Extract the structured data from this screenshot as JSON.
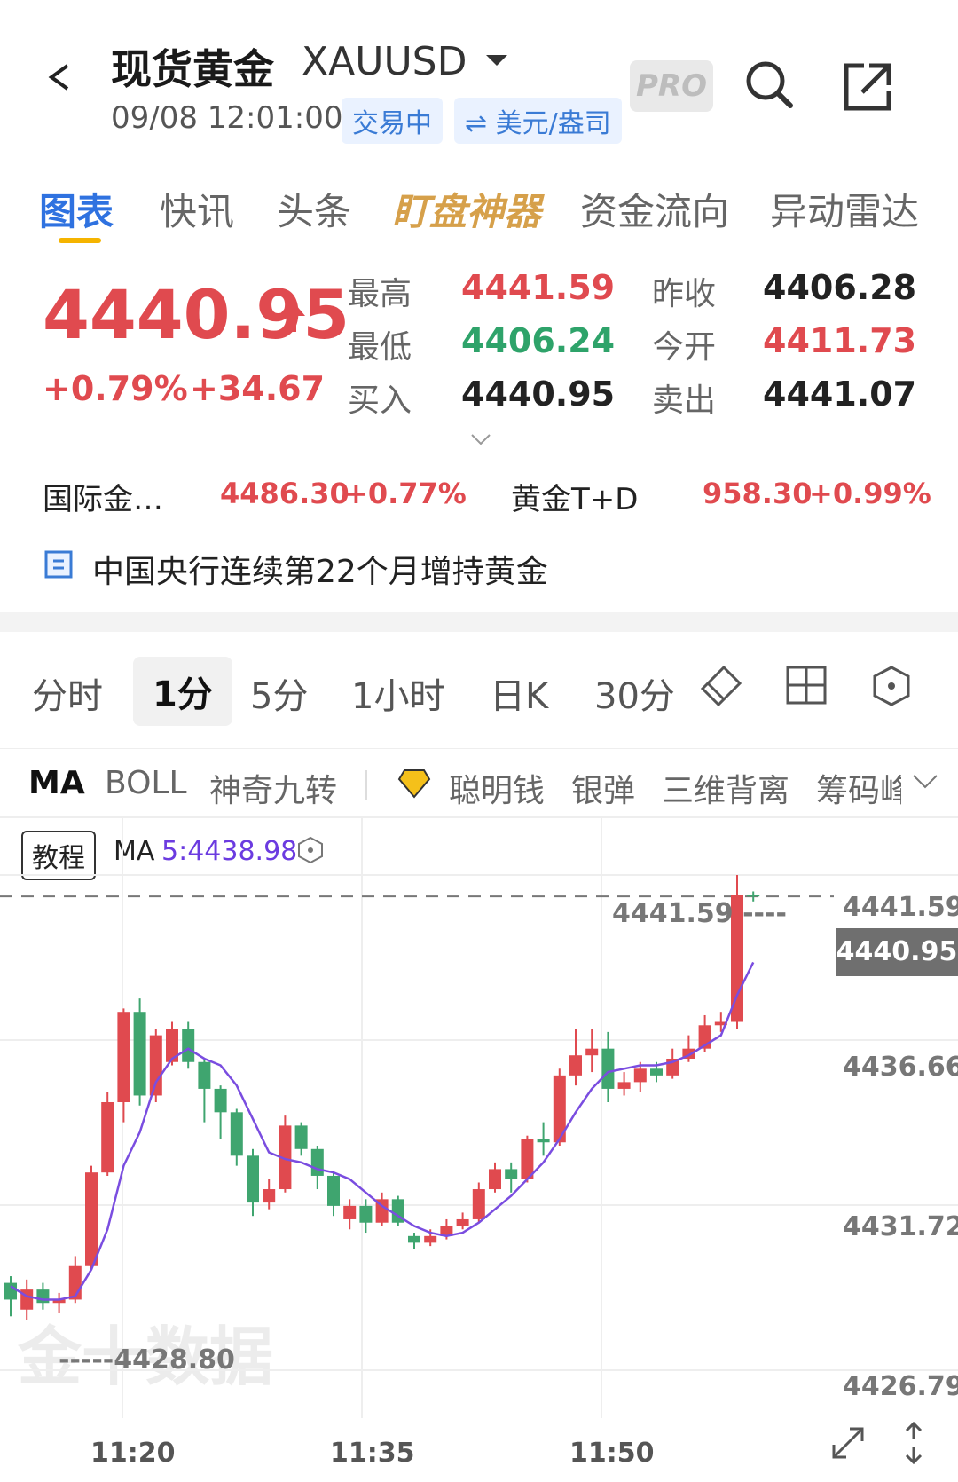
{
  "header": {
    "title": "现货黄金",
    "symbol": "XAUUSD",
    "datetime": "09/08 12:01:00",
    "status_badge": "交易中",
    "currency_badge": "⇌ 美元/盎司",
    "pro_label": "PRO"
  },
  "tabs": [
    {
      "label": "图表",
      "active": true
    },
    {
      "label": "快讯"
    },
    {
      "label": "头条"
    },
    {
      "label": "盯盘神器"
    },
    {
      "label": "资金流向"
    },
    {
      "label": "异动雷达"
    }
  ],
  "quote": {
    "price": "4440.95",
    "pct_change": "+0.79%",
    "abs_change": "+34.67",
    "stats": [
      {
        "label": "最高",
        "value": "4441.59",
        "color": "red"
      },
      {
        "label": "昨收",
        "value": "4406.28",
        "color": "dark"
      },
      {
        "label": "最低",
        "value": "4406.24",
        "color": "green"
      },
      {
        "label": "今开",
        "value": "4411.73",
        "color": "red"
      },
      {
        "label": "买入",
        "value": "4440.95",
        "color": "dark"
      },
      {
        "label": "卖出",
        "value": "4441.07",
        "color": "dark"
      }
    ]
  },
  "related": [
    {
      "label": "国际金…",
      "value": "4486.30",
      "change": "+0.77%"
    },
    {
      "label": "黄金T+D",
      "value": "958.30",
      "change": "+0.99%"
    }
  ],
  "news_headline": "中国央行连续第22个月增持黄金",
  "periods": [
    {
      "label": "分时"
    },
    {
      "label": "1分",
      "active": true
    },
    {
      "label": "5分"
    },
    {
      "label": "1小时"
    },
    {
      "label": "日K"
    },
    {
      "label": "30分"
    }
  ],
  "indicators": [
    {
      "label": "MA",
      "active": true
    },
    {
      "label": "BOLL"
    },
    {
      "label": "神奇九转"
    },
    {
      "label": "聪明钱"
    },
    {
      "label": "银弹"
    },
    {
      "label": "三维背离"
    },
    {
      "label": "筹码峰"
    }
  ],
  "chart_header": {
    "tutorial_label": "教程",
    "ma_label": "MA",
    "ma_value": "5:4438.98"
  },
  "chart_data": {
    "type": "candlestick",
    "y_ticks": [
      "4441.59",
      "4436.66",
      "4431.72",
      "4426.79"
    ],
    "x_ticks": [
      "11:20",
      "11:35",
      "11:50"
    ],
    "high_marker": "4441.59 ----",
    "low_marker": "-----4428.80",
    "current_price": "4440.95",
    "watermark": "金十数据",
    "ylim": [
      4426.79,
      4441.59
    ],
    "colors": {
      "up": "#e04a4f",
      "down": "#3fa56f",
      "ma": "#7a4de0"
    },
    "candles": [
      {
        "t": "11:13",
        "o": 4429.4,
        "c": 4428.9,
        "h": 4429.6,
        "l": 4428.4
      },
      {
        "t": "11:14",
        "o": 4428.6,
        "c": 4429.2,
        "h": 4429.5,
        "l": 4428.3
      },
      {
        "t": "11:15",
        "o": 4429.2,
        "c": 4428.8,
        "h": 4429.4,
        "l": 4428.6
      },
      {
        "t": "11:16",
        "o": 4428.8,
        "c": 4428.9,
        "h": 4429.1,
        "l": 4428.5
      },
      {
        "t": "11:17",
        "o": 4428.9,
        "c": 4429.9,
        "h": 4430.2,
        "l": 4428.8
      },
      {
        "t": "11:18",
        "o": 4429.9,
        "c": 4432.7,
        "h": 4432.9,
        "l": 4429.8
      },
      {
        "t": "11:19",
        "o": 4432.7,
        "c": 4434.8,
        "h": 4435.1,
        "l": 4432.6
      },
      {
        "t": "11:20",
        "o": 4434.8,
        "c": 4437.5,
        "h": 4437.6,
        "l": 4434.2
      },
      {
        "t": "11:21",
        "o": 4437.5,
        "c": 4435.0,
        "h": 4437.9,
        "l": 4434.7
      },
      {
        "t": "11:22",
        "o": 4435.0,
        "c": 4436.8,
        "h": 4437.0,
        "l": 4434.8
      },
      {
        "t": "11:23",
        "o": 4436.0,
        "c": 4437.0,
        "h": 4437.2,
        "l": 4435.9
      },
      {
        "t": "11:24",
        "o": 4437.0,
        "c": 4436.0,
        "h": 4437.2,
        "l": 4435.8
      },
      {
        "t": "11:25",
        "o": 4436.0,
        "c": 4435.2,
        "h": 4436.1,
        "l": 4434.2
      },
      {
        "t": "11:26",
        "o": 4435.2,
        "c": 4434.5,
        "h": 4435.3,
        "l": 4433.7
      },
      {
        "t": "11:27",
        "o": 4434.5,
        "c": 4433.2,
        "h": 4434.6,
        "l": 4432.9
      },
      {
        "t": "11:28",
        "o": 4433.2,
        "c": 4431.8,
        "h": 4433.4,
        "l": 4431.4
      },
      {
        "t": "11:29",
        "o": 4431.8,
        "c": 4432.2,
        "h": 4432.5,
        "l": 4431.6
      },
      {
        "t": "11:30",
        "o": 4432.2,
        "c": 4434.1,
        "h": 4434.4,
        "l": 4432.1
      },
      {
        "t": "11:31",
        "o": 4434.1,
        "c": 4433.4,
        "h": 4434.2,
        "l": 4433.2
      },
      {
        "t": "11:32",
        "o": 4433.4,
        "c": 4432.6,
        "h": 4433.5,
        "l": 4432.2
      },
      {
        "t": "11:33",
        "o": 4432.6,
        "c": 4431.7,
        "h": 4432.7,
        "l": 4431.4
      },
      {
        "t": "11:34",
        "o": 4431.3,
        "c": 4431.7,
        "h": 4431.9,
        "l": 4431.0
      },
      {
        "t": "11:35",
        "o": 4431.7,
        "c": 4431.2,
        "h": 4431.9,
        "l": 4430.9
      },
      {
        "t": "11:36",
        "o": 4431.2,
        "c": 4431.9,
        "h": 4432.1,
        "l": 4431.1
      },
      {
        "t": "11:37",
        "o": 4431.9,
        "c": 4431.2,
        "h": 4432.0,
        "l": 4431.1
      },
      {
        "t": "11:38",
        "o": 4430.8,
        "c": 4430.6,
        "h": 4430.9,
        "l": 4430.4
      },
      {
        "t": "11:39",
        "o": 4430.6,
        "c": 4430.8,
        "h": 4431.0,
        "l": 4430.5
      },
      {
        "t": "11:40",
        "o": 4430.8,
        "c": 4431.1,
        "h": 4431.3,
        "l": 4430.7
      },
      {
        "t": "11:41",
        "o": 4431.1,
        "c": 4431.3,
        "h": 4431.5,
        "l": 4431.0
      },
      {
        "t": "11:42",
        "o": 4431.3,
        "c": 4432.2,
        "h": 4432.4,
        "l": 4431.2
      },
      {
        "t": "11:43",
        "o": 4432.2,
        "c": 4432.8,
        "h": 4433.0,
        "l": 4432.1
      },
      {
        "t": "11:44",
        "o": 4432.8,
        "c": 4432.5,
        "h": 4433.0,
        "l": 4432.1
      },
      {
        "t": "11:45",
        "o": 4432.5,
        "c": 4433.7,
        "h": 4433.8,
        "l": 4432.4
      },
      {
        "t": "11:46",
        "o": 4433.7,
        "c": 4433.6,
        "h": 4434.2,
        "l": 4433.2
      },
      {
        "t": "11:47",
        "o": 4433.6,
        "c": 4435.6,
        "h": 4435.8,
        "l": 4433.5
      },
      {
        "t": "11:48",
        "o": 4435.6,
        "c": 4436.2,
        "h": 4437.0,
        "l": 4435.3
      },
      {
        "t": "11:49",
        "o": 4436.2,
        "c": 4436.4,
        "h": 4437.0,
        "l": 4435.7
      },
      {
        "t": "11:50",
        "o": 4436.4,
        "c": 4435.2,
        "h": 4436.9,
        "l": 4434.8
      },
      {
        "t": "11:51",
        "o": 4435.2,
        "c": 4435.4,
        "h": 4435.7,
        "l": 4435.0
      },
      {
        "t": "11:52",
        "o": 4435.4,
        "c": 4435.8,
        "h": 4436.0,
        "l": 4435.1
      },
      {
        "t": "11:53",
        "o": 4435.8,
        "c": 4435.6,
        "h": 4436.0,
        "l": 4435.4
      },
      {
        "t": "11:54",
        "o": 4435.6,
        "c": 4436.1,
        "h": 4436.4,
        "l": 4435.5
      },
      {
        "t": "11:55",
        "o": 4436.1,
        "c": 4436.4,
        "h": 4436.8,
        "l": 4436.0
      },
      {
        "t": "11:56",
        "o": 4436.4,
        "c": 4437.1,
        "h": 4437.4,
        "l": 4436.3
      },
      {
        "t": "11:57",
        "o": 4437.1,
        "c": 4437.2,
        "h": 4437.5,
        "l": 4436.9
      },
      {
        "t": "11:58",
        "o": 4437.2,
        "c": 4441.0,
        "h": 4441.59,
        "l": 4437.0
      },
      {
        "t": "11:59",
        "o": 4441.0,
        "c": 4440.95,
        "h": 4441.1,
        "l": 4440.8
      }
    ],
    "ma5": [
      4429.3,
      4429.0,
      4428.9,
      4428.9,
      4429.0,
      4429.8,
      4431.0,
      4432.9,
      4433.9,
      4435.4,
      4436.1,
      4436.4,
      4436.1,
      4435.9,
      4435.3,
      4434.3,
      4433.3,
      4433.1,
      4433.0,
      4432.8,
      4432.7,
      4432.5,
      4432.1,
      4431.7,
      4431.4,
      4431.1,
      4430.9,
      4430.8,
      4430.9,
      4431.2,
      4431.6,
      4432.0,
      4432.5,
      4433.0,
      4433.7,
      4434.5,
      4435.2,
      4435.7,
      4435.8,
      4435.9,
      4435.9,
      4436.0,
      4436.2,
      4436.5,
      4436.8,
      4438.0,
      4438.98
    ]
  }
}
